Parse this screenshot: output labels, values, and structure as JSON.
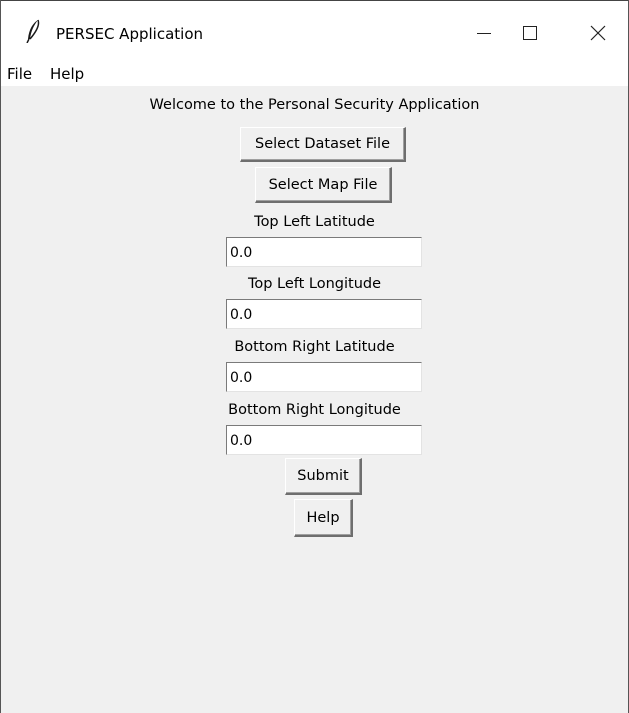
{
  "window": {
    "title": "PERSEC Application",
    "icon": "feather-icon",
    "controls": {
      "minimize_icon": "minimize-icon",
      "maximize_icon": "maximize-icon",
      "close_icon": "close-icon"
    }
  },
  "menubar": {
    "items": [
      {
        "label": "File"
      },
      {
        "label": "Help"
      }
    ]
  },
  "main": {
    "welcome": "Welcome to the Personal Security Application",
    "select_dataset_label": "Select Dataset File",
    "select_map_label": "Select Map File",
    "fields": [
      {
        "label": "Top Left Latitude",
        "value": "0.0"
      },
      {
        "label": "Top Left Longitude",
        "value": "0.0"
      },
      {
        "label": "Bottom Right Latitude",
        "value": "0.0"
      },
      {
        "label": "Bottom Right Longitude",
        "value": "0.0"
      }
    ],
    "submit_label": "Submit",
    "help_label": "Help"
  }
}
